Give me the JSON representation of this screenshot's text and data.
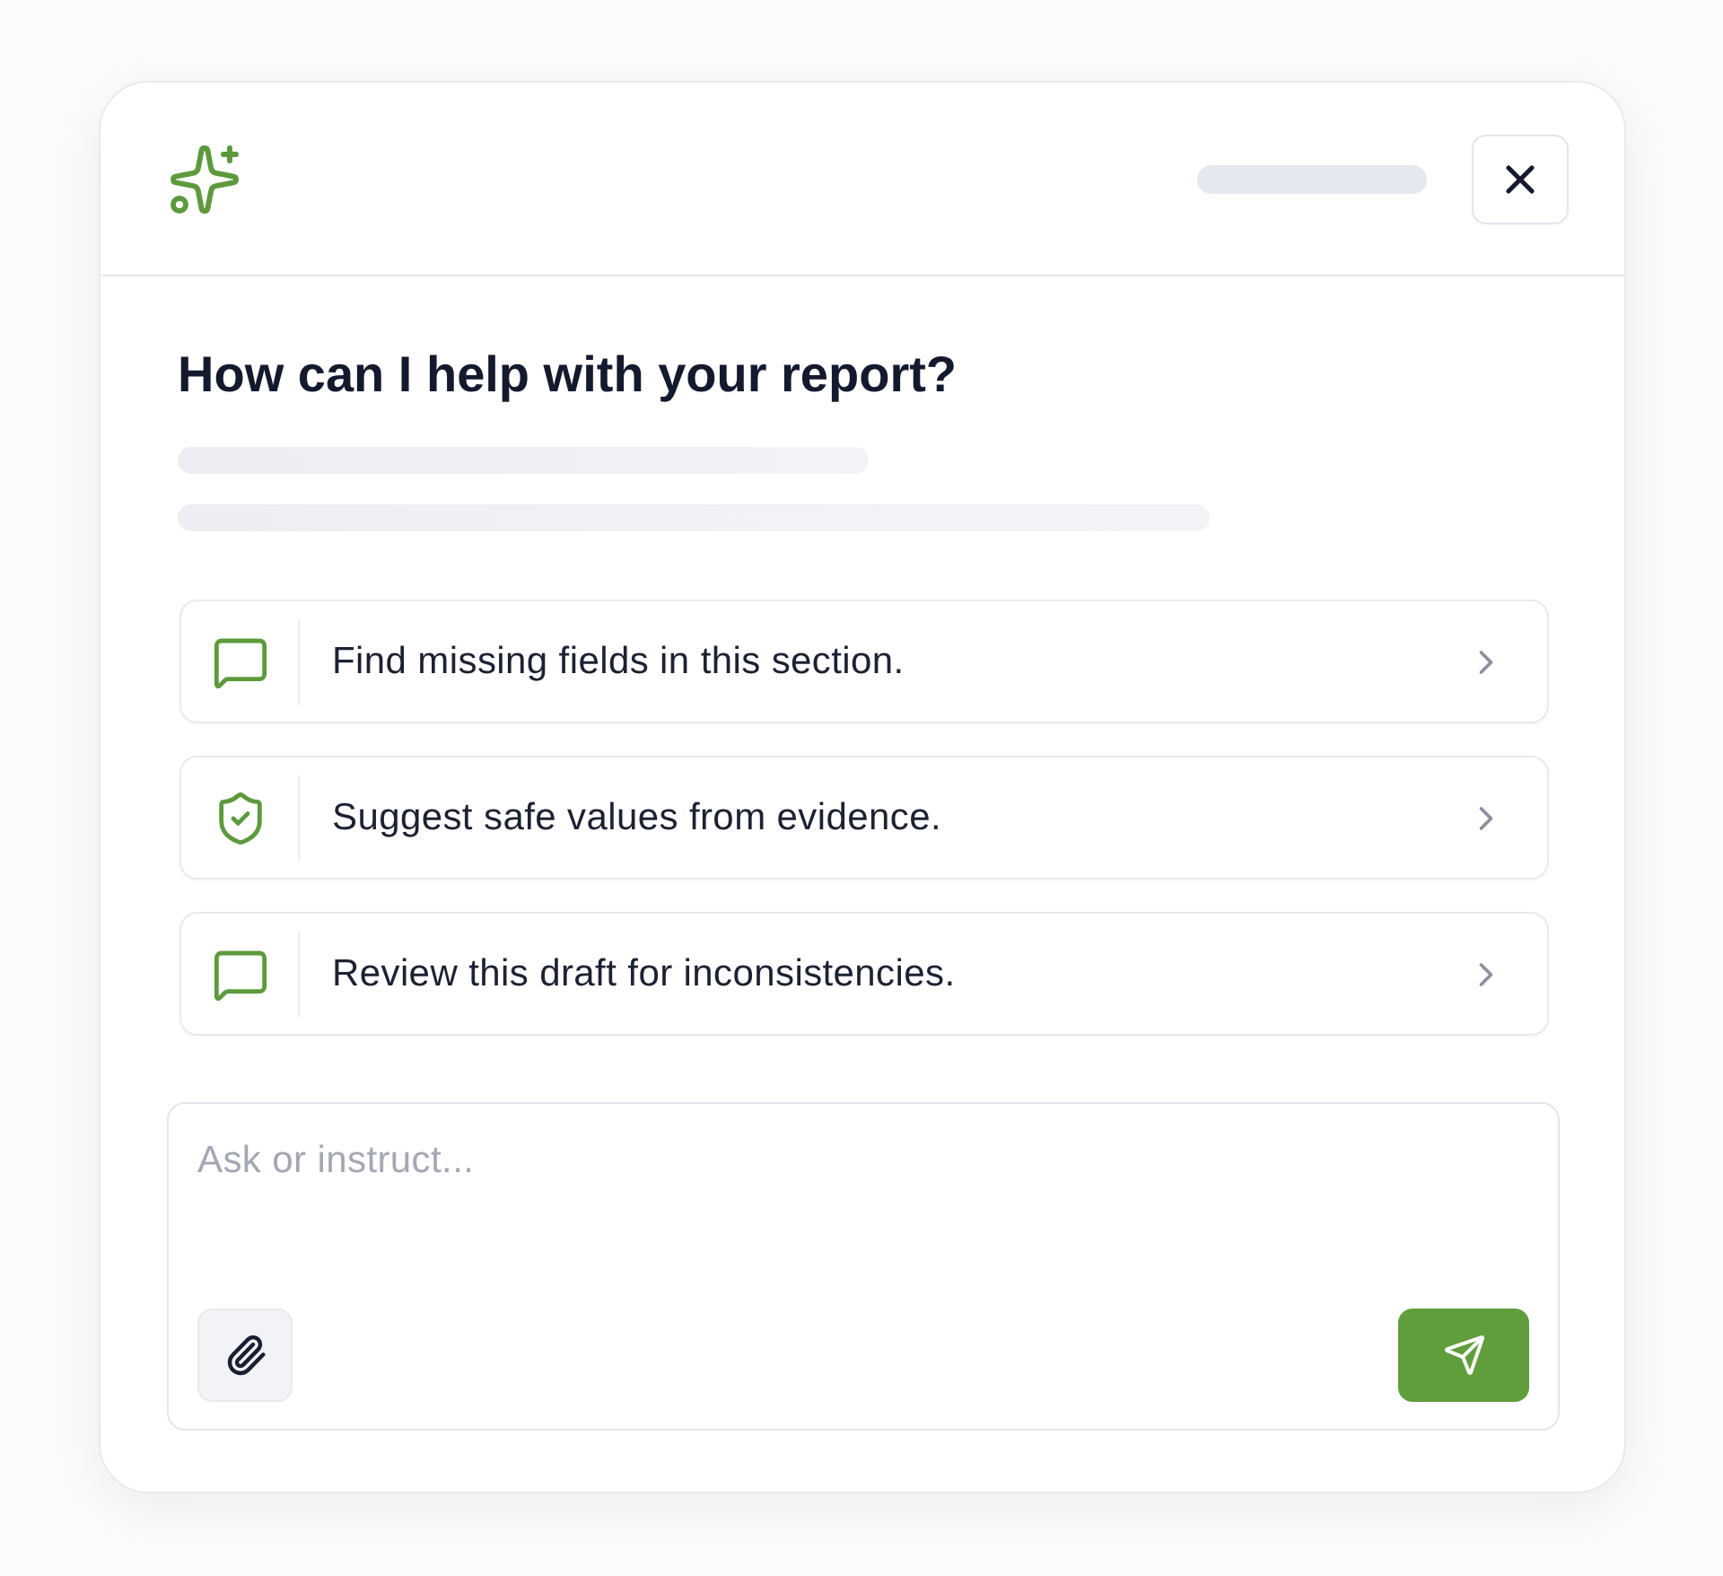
{
  "title": "How can I help with your report?",
  "suggestions": [
    {
      "kind": "chat",
      "text": "Find missing fields in this section."
    },
    {
      "kind": "shield",
      "text": "Suggest safe values from evidence."
    },
    {
      "kind": "chat",
      "text": "Review this draft for inconsistencies."
    }
  ],
  "composer": {
    "placeholder": "Ask or instruct..."
  }
}
